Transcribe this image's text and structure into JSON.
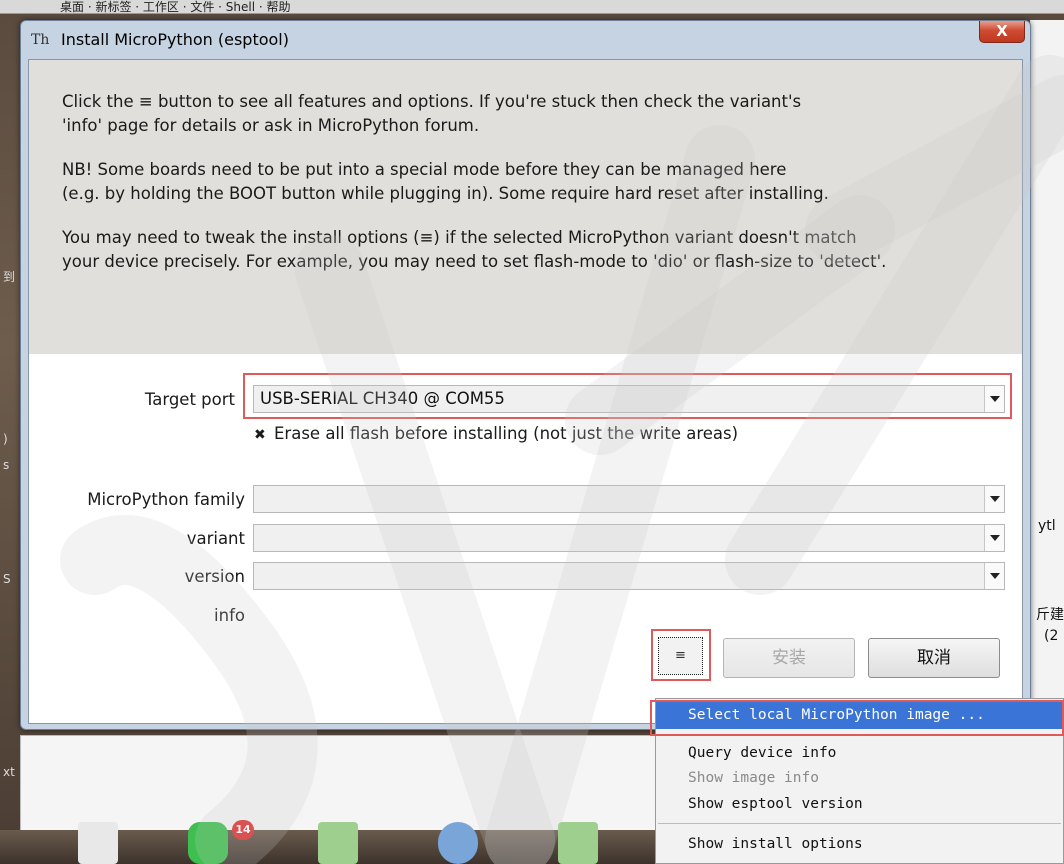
{
  "background": {
    "top_menu_text": "桌面 · 新标签 · 工作区 · 文件 · Shell · 帮助",
    "left_texts": [
      "到",
      ")",
      "s",
      "S",
      "xt"
    ],
    "right_texts": [
      "ytl",
      "斤建",
      "(2"
    ],
    "taskbar_badge": "14"
  },
  "dialog": {
    "title": "Install MicroPython (esptool)",
    "close_icon": "close-icon",
    "close_glyph": "X",
    "title_glyph": "Th",
    "intro_paragraphs": [
      "Click the ≡ button to see all features and options. If you're stuck then check the variant's\n'info' page for details or ask in MicroPython forum.",
      "NB! Some boards need to be put into a special mode before they can be managed here\n(e.g. by holding the BOOT button while plugging in). Some require hard reset after installing.",
      "You may need to tweak the install options (≡) if the selected MicroPython variant doesn't match\nyour device precisely. For example, you may need to set flash-mode to 'dio' or flash-size to 'detect'."
    ],
    "form": {
      "target_port_label": "Target port",
      "target_port_value": "USB-SERIAL CH340 @ COM55",
      "erase_checkbox_glyph": "✖",
      "erase_label": "Erase all flash before installing (not just the write areas)",
      "erase_checked": true,
      "family_label": "MicroPython family",
      "family_value": "",
      "variant_label": "variant",
      "variant_value": "",
      "version_label": "version",
      "version_value": "",
      "info_label": "info"
    },
    "buttons": {
      "menu_label": "≡",
      "install_label": "安装",
      "cancel_label": "取消"
    }
  },
  "popup_menu": {
    "items": [
      {
        "label": "Select local MicroPython image ...",
        "state": "selected"
      },
      {
        "label": "Query device info",
        "state": "enabled"
      },
      {
        "label": "Show image info",
        "state": "disabled"
      },
      {
        "label": "Show esptool version",
        "state": "enabled"
      },
      {
        "label": "Show install options",
        "state": "enabled"
      }
    ]
  },
  "colors": {
    "highlight": "#e05a5a",
    "selection": "#3a74d6",
    "intro_bg": "#e0dfdb"
  }
}
